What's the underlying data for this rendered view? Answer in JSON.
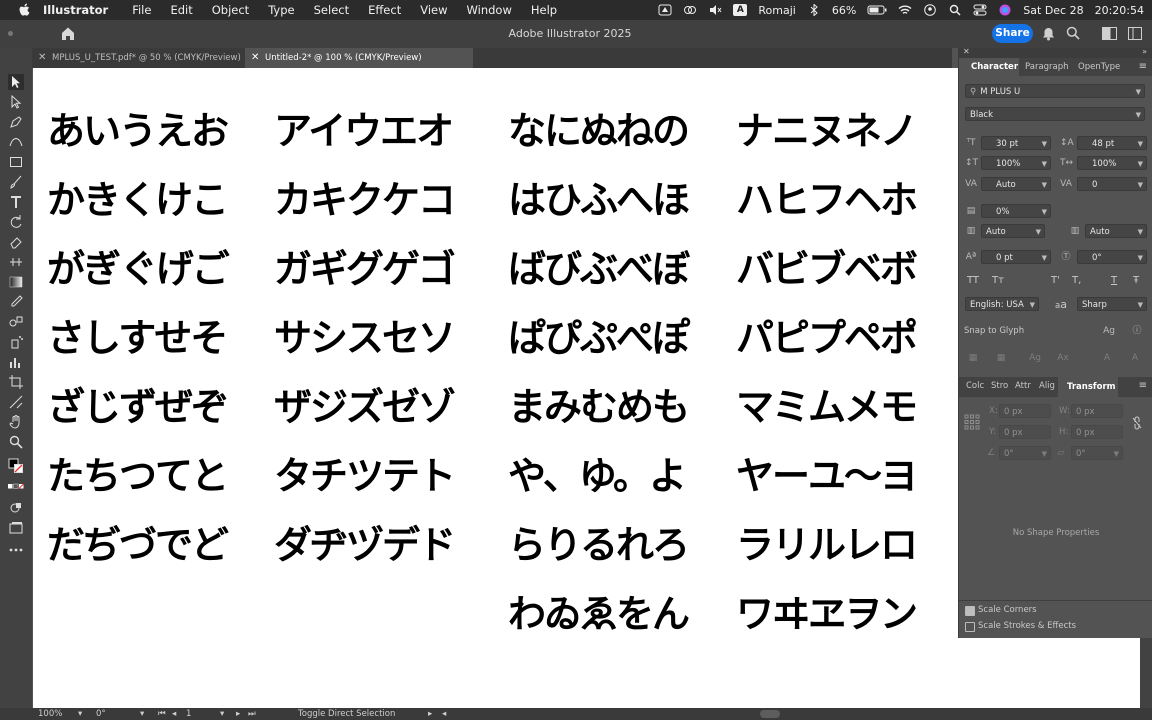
{
  "menubar": {
    "app_name": "Illustrator",
    "items": [
      "File",
      "Edit",
      "Object",
      "Type",
      "Select",
      "Effect",
      "View",
      "Window",
      "Help"
    ],
    "status": {
      "input_source_letter": "A",
      "input_method": "Romaji",
      "battery": "66%",
      "date": "Sat Dec 28",
      "time": "20:20:54"
    }
  },
  "window": {
    "title": "Adobe Illustrator 2025",
    "share_label": "Share"
  },
  "document_tabs": [
    {
      "label": "MPLUS_U_TEST.pdf* @ 50 % (CMYK/Preview)",
      "active": false
    },
    {
      "label": "Untitled-2* @ 100 % (CMYK/Preview)",
      "active": true
    }
  ],
  "artboard": {
    "columns": [
      [
        "あいうえお",
        "かきくけこ",
        "がぎぐげご",
        "さしすせそ",
        "ざじずぜぞ",
        "たちつてと",
        "だぢづでど"
      ],
      [
        "アイウエオ",
        "カキクケコ",
        "ガギグゲゴ",
        "サシスセソ",
        "ザジズゼゾ",
        "タチツテト",
        "ダヂヅデド"
      ],
      [
        "なにぬねの",
        "はひふへほ",
        "ばびぶべぼ",
        "ぱぴぷぺぽ",
        "まみむめも",
        "や、ゆ。よ",
        "らりるれろ",
        "わゐゑをん"
      ],
      [
        "ナニヌネノ",
        "ハヒフヘホ",
        "バビブベボ",
        "パピプペポ",
        "マミムメモ",
        "ヤーユ～ヨ",
        "ラリルレロ",
        "ワヰヱヲン"
      ]
    ]
  },
  "character_panel": {
    "tabs": [
      "Character",
      "Paragraph",
      "OpenType"
    ],
    "active_tab": "Character",
    "font_family": "M PLUS U",
    "font_style": "Black",
    "font_size": "30 pt",
    "leading": "48 pt",
    "vertical_scale": "100%",
    "horizontal_scale": "100%",
    "kerning": "Auto",
    "tracking": "0",
    "tsume": "0%",
    "aki_left": "Auto",
    "aki_right": "Auto",
    "baseline_shift": "0 pt",
    "rotation": "0°",
    "language": "English: USA",
    "antialias": "Sharp",
    "snap_to_glyph": "Snap to Glyph",
    "case_buttons": [
      "TT",
      "Tт",
      "T'",
      "T,",
      "T",
      "Ŧ"
    ],
    "aa_label": "a",
    "aa_big": "a"
  },
  "transform_panel": {
    "tabs": [
      "Colc",
      "Stro",
      "Attr",
      "Alig",
      "Transform"
    ],
    "active_tab": "Transform",
    "x_label": "X:",
    "y_label": "Y:",
    "w_label": "W:",
    "h_label": "H:",
    "x_value": "0 px",
    "y_value": "0 px",
    "w_value": "0 px",
    "h_value": "0 px",
    "angle_value": "0°",
    "shear_value": "0°",
    "empty_message": "No Shape Properties",
    "scale_corners_label": "Scale Corners",
    "scale_corners_checked": true,
    "scale_strokes_label": "Scale Strokes & Effects",
    "scale_strokes_checked": false
  },
  "status_bar": {
    "zoom": "100%",
    "rotation": "0°",
    "artboard_number": "1",
    "tool_hint": "Toggle Direct Selection"
  },
  "colors": {
    "share_blue": "#1473e6",
    "panel_bg": "#535353",
    "canvas_bg": "#ffffff"
  }
}
